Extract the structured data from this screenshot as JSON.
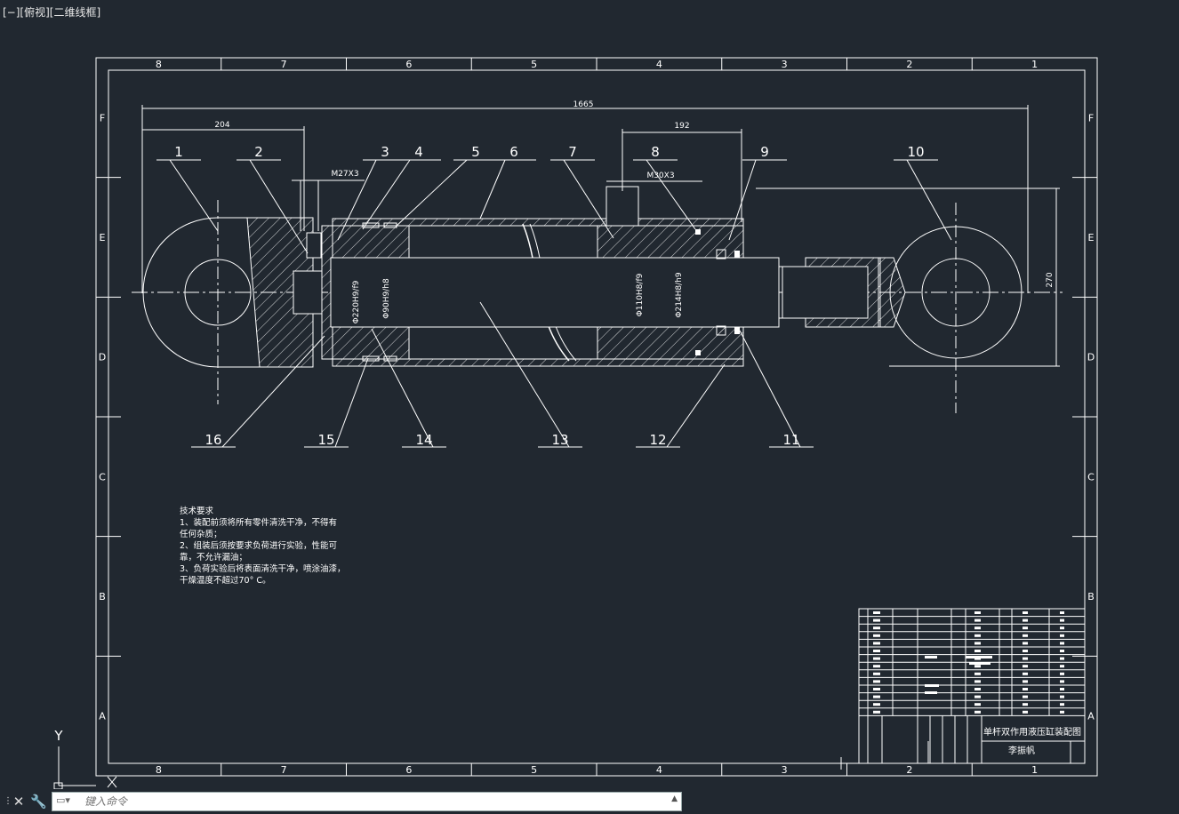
{
  "viewport": {
    "label": "[−][俯视][二维线框]"
  },
  "frame": {
    "columns": [
      "8",
      "7",
      "6",
      "5",
      "4",
      "3",
      "2",
      "1"
    ],
    "rows": [
      "F",
      "E",
      "D",
      "C",
      "B",
      "A"
    ]
  },
  "dimensions": {
    "overall_length": "1665",
    "left_eye": "204",
    "port_distance": "192",
    "left_thread": "M27X3",
    "right_thread": "M30X3",
    "height": "270",
    "bore_fit": "Φ220H9/f9",
    "rod_guide_fit": "Φ90H9/h8",
    "rod_fit": "Φ110H8/f9",
    "piston_fit": "Φ214H8/h9"
  },
  "balloons": [
    "1",
    "2",
    "3",
    "4",
    "5",
    "6",
    "7",
    "8",
    "9",
    "10",
    "11",
    "12",
    "13",
    "14",
    "15",
    "16"
  ],
  "notes": {
    "title": "技术要求",
    "lines": [
      "1、装配前须将所有零件清洗干净，不得有",
      "任何杂质；",
      "2、组装后须按要求负荷进行实验，性能可",
      "靠，不允许漏油；",
      "3、负荷实验后将表面清洗干净，喷涂油漆，",
      "干燥温度不超过70° C。"
    ]
  },
  "titleblock": {
    "drawing_title": "单杆双作用液压缸装配图",
    "designer": "李振帆"
  },
  "ucs": {
    "y_label": "Y"
  },
  "command": {
    "placeholder": "键入命令"
  },
  "colors": {
    "background": "#212830",
    "line": "#ffffff"
  }
}
